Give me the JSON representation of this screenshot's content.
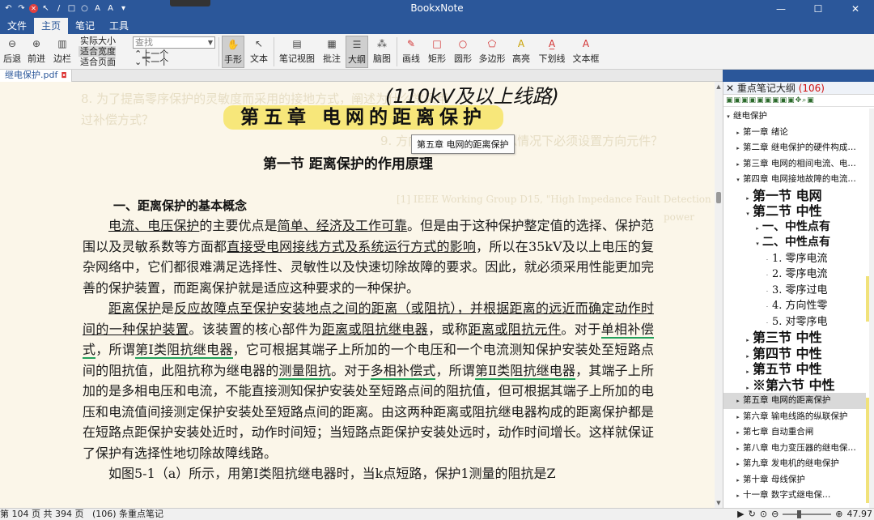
{
  "window": {
    "title": "BookxNote"
  },
  "menu": {
    "tabs": [
      "文件",
      "主页",
      "笔记",
      "工具"
    ],
    "active": 1
  },
  "toolbar": {
    "back": "后退",
    "forward": "前进",
    "sidebar": "边栏",
    "zoom_options": [
      "实际大小",
      "适合宽度",
      "适合页面"
    ],
    "zoom_selected": 1,
    "search_placeholder": "查找",
    "prev": "上一个",
    "next": "下一个",
    "hand": "手形",
    "text": "文本",
    "note_view": "笔记视图",
    "annotation": "批注",
    "outline": "大纲",
    "mindmap": "脑图",
    "line": "画线",
    "rect": "矩形",
    "circle": "圆形",
    "polygon": "多边形",
    "highlight": "高亮",
    "underline": "下划线",
    "textbox": "文本框"
  },
  "doc_tab": {
    "name": "继电保护.pdf"
  },
  "page": {
    "handwritten_note": "(110kV及以上线路)",
    "chapter_title": "第五章 电网的距离保护",
    "tooltip": "第五章 电网的距离保护",
    "section_title": "第一节 距离保护的作用原理",
    "subheading": "一、距离保护的基本概念",
    "p1_a": "电流、电压保护",
    "p1_b": "的主要优点是",
    "p1_c": "简单、经济及工作可靠",
    "p1_d": "。但是由于这种保护整定值的选择、保护范围以及灵敏系数等方面都",
    "p1_e": "直接受电网接线方式及系统运行方式的影响",
    "p1_f": "，所以在35kV及以上电压的复杂网络中，它们都很难满足选择性、灵敏性以及快速切除故障的要求。因此，就必须采用性能更加完善的保护装置，而距离保护就是适应这种要求的一种保护。",
    "p2_a": "距离保护",
    "p2_b": "是",
    "p2_c": "反应故障点至保护安装地点之间的距离（或阻抗），并根据距离的远近而确定动作时间的一种保护装置",
    "p2_d": "。该装置的核心部件为",
    "p2_e": "距离或阻抗继电器",
    "p2_f": "，或称",
    "p2_g": "距离或阻抗元件",
    "p2_h": "。对于",
    "p2_i": "单相补偿式",
    "p2_j": "，所谓",
    "p2_k": "第Ⅰ类阻抗继电器",
    "p2_l": "，它可根据其端子上所加的一个电压和一个电流测知保护安装处至短路点间的阻抗值，此阻抗称为继电器的",
    "p2_m": "测量阻抗",
    "p2_n": "。对于",
    "p2_o": "多相补偿式",
    "p2_p": "，所谓",
    "p2_q": "第Ⅱ类阻抗继电器",
    "p2_r": "，其端子上所加的是多相电压和电流，不能直接测知保护安装处至短路点间的阻抗值，但可根据其端子上所加的电压和电流值间接测定保护安装处至短路点间的距离。由这两种距离或阻抗继电器构成的距离保护都是在短路点距保护安装处近时，动作时间短；当短路点距保护安装处远时，动作时间增长。这样就保证了保护有选择性地切除故障线路。",
    "p3": "如图5-1（a）所示，用第Ⅰ类阻抗继电器时，当k点短路，保护1测量的阻抗是Z",
    "ghost_1": "8. 为了提高零序保护的灵敏度而采用的接地方式，阐述为什么常采用",
    "ghost_2": "过补偿方式？",
    "ghost_3": "9. 方向性接地保护在什么情况下必须设置方向元件？",
    "ghost_4": "[1] IEEE Working Group D15, \"High Impedance Fault Detection",
    "ghost_5": "power"
  },
  "outline": {
    "title": "重点笔记大纲",
    "count": "(106)",
    "root": "继电保护",
    "items": [
      {
        "label": "第一章 绪论",
        "style": "normal",
        "indent": 1,
        "expand": "▸"
      },
      {
        "label": "第二章 继电保护的硬件构成…",
        "style": "normal",
        "indent": 1,
        "expand": "▸"
      },
      {
        "label": "第三章 电网的相间电流、电…",
        "style": "normal",
        "indent": 1,
        "expand": "▸"
      },
      {
        "label": "第四章 电网接地故障的电流…",
        "style": "normal",
        "indent": 1,
        "expand": "▾"
      },
      {
        "label": "第一节 电网",
        "style": "big",
        "indent": 2,
        "expand": "▸"
      },
      {
        "label": "第二节 中性",
        "style": "big",
        "indent": 2,
        "expand": "▾"
      },
      {
        "label": "一、中性点有",
        "style": "med",
        "indent": 3,
        "expand": "▸"
      },
      {
        "label": "二、中性点有",
        "style": "med",
        "indent": 3,
        "expand": "▾"
      },
      {
        "label": "1. 零序电流",
        "style": "sm",
        "indent": 4,
        "expand": "·"
      },
      {
        "label": "2. 零序电流",
        "style": "sm",
        "indent": 4,
        "expand": "·"
      },
      {
        "label": "3. 零序过电",
        "style": "sm",
        "indent": 4,
        "expand": "·"
      },
      {
        "label": "4. 方向性零",
        "style": "sm",
        "indent": 4,
        "expand": "·"
      },
      {
        "label": "5. 对零序电",
        "style": "sm",
        "indent": 4,
        "expand": "·"
      },
      {
        "label": "第三节 中性",
        "style": "big",
        "indent": 2,
        "expand": "▸"
      },
      {
        "label": "第四节 中性",
        "style": "big",
        "indent": 2,
        "expand": "▸"
      },
      {
        "label": "第五节 中性",
        "style": "big",
        "indent": 2,
        "expand": "▸"
      },
      {
        "label": "※第六节 中性",
        "style": "big",
        "indent": 2,
        "expand": "▸"
      },
      {
        "label": "第五章 电网的距离保护",
        "style": "selected",
        "indent": 1,
        "expand": "▸"
      },
      {
        "label": "第六章 输电线路的纵联保护",
        "style": "normal",
        "indent": 1,
        "expand": "▸"
      },
      {
        "label": "第七章 自动重合闸",
        "style": "normal",
        "indent": 1,
        "expand": "▸"
      },
      {
        "label": "第八章 电力变压器的继电保…",
        "style": "normal",
        "indent": 1,
        "expand": "▸"
      },
      {
        "label": "第九章 发电机的继电保护",
        "style": "normal",
        "indent": 1,
        "expand": "▸"
      },
      {
        "label": "第十章 母线保护",
        "style": "normal",
        "indent": 1,
        "expand": "▸"
      },
      {
        "label": "十一章 数字式继电保…",
        "style": "normal",
        "indent": 1,
        "expand": "▸"
      }
    ]
  },
  "status": {
    "page_info": "第 104 页 共 394 页",
    "notes_info": "(106) 条重点笔记",
    "zoom": "47.97"
  },
  "colors": {
    "accent": "#2b579a",
    "highlight": "#f7e77a",
    "page_bg": "#fbf6e9",
    "red": "#d01010"
  }
}
